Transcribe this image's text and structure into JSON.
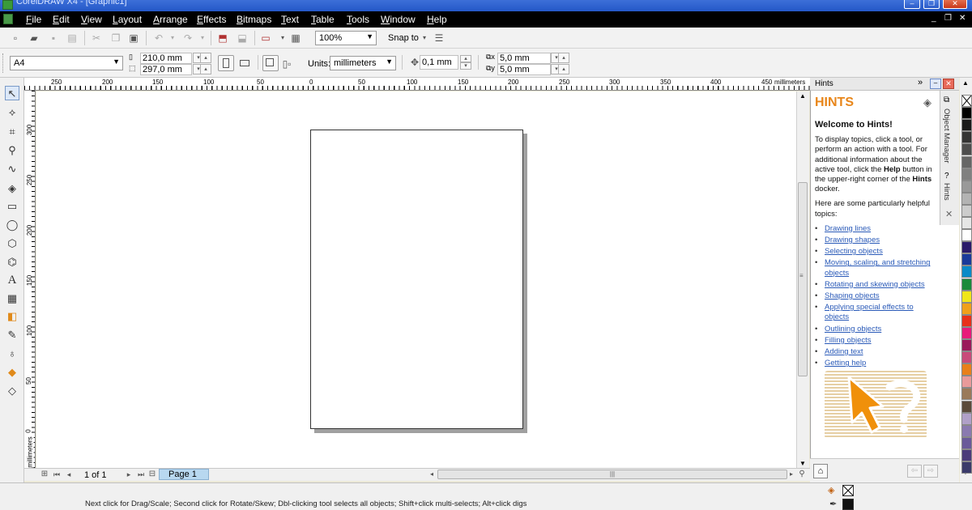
{
  "window": {
    "title": "CorelDRAW X4 - [Graphic1]"
  },
  "menu": [
    "File",
    "Edit",
    "View",
    "Layout",
    "Arrange",
    "Effects",
    "Bitmaps",
    "Text",
    "Table",
    "Tools",
    "Window",
    "Help"
  ],
  "toolbar": {
    "zoom_value": "100%",
    "snap_label": "Snap to"
  },
  "property_bar": {
    "paper_size": "A4",
    "width": "210,0 mm",
    "height": "297,0 mm",
    "units_label": "Units:",
    "units_value": "millimeters",
    "nudge": "0,1 mm",
    "dup_x": "5,0 mm",
    "dup_y": "5,0 mm"
  },
  "rulers": {
    "h_unit": "millimeters",
    "h_ticks": [
      "250",
      "200",
      "150",
      "100",
      "50",
      "0",
      "50",
      "100",
      "150",
      "200",
      "250",
      "300",
      "350",
      "400",
      "450"
    ],
    "v_unit": "millimeters",
    "v_ticks": [
      "300",
      "250",
      "200",
      "150",
      "100",
      "50",
      "0"
    ]
  },
  "page_nav": {
    "count_text": "1 of 1",
    "page_tab": "Page 1"
  },
  "hints": {
    "docker_title": "Hints",
    "heading": "HINTS",
    "welcome": "Welcome to Hints!",
    "intro_before": "To display topics, click a tool, or perform an action with a tool. For additional information about the active tool, click the ",
    "intro_bold1": "Help",
    "intro_mid": " button in the upper-right corner of the ",
    "intro_bold2": "Hints",
    "intro_after": " docker.",
    "helpful": "Here are some particularly helpful topics:",
    "topics": [
      "Drawing lines",
      "Drawing shapes",
      "Selecting objects",
      "Moving, scaling, and stretching objects",
      "Rotating and skewing objects",
      "Shaping objects",
      "Applying special effects to objects",
      "Outlining objects",
      "Filling objects",
      "Adding text",
      "Getting help"
    ]
  },
  "docker_tabs": [
    "Object Manager",
    "Hints"
  ],
  "palette": [
    "#ffffff",
    "#000000",
    "#1a1a1a",
    "#333333",
    "#4d4d4d",
    "#666666",
    "#808080",
    "#999999",
    "#b3b3b3",
    "#cccccc",
    "#e6e6e6",
    "#ffffff",
    "#2a1a6a",
    "#1a3a9a",
    "#0a8ac8",
    "#1a8a3a",
    "#f0e61a",
    "#f0a01a",
    "#e8301a",
    "#e81a7a",
    "#9a1a5a",
    "#c84a7a",
    "#e8801a",
    "#e89a9a",
    "#9a7a5a",
    "#5a4a3a",
    "#b0a0c8",
    "#8a7ab0",
    "#6a5a9a",
    "#4a3a7a",
    "#3a3a6a"
  ],
  "status": {
    "text": "Next click for Drag/Scale; Second click for Rotate/Skew; Dbl-clicking tool selects all objects; Shift+click multi-selects; Alt+click digs"
  }
}
